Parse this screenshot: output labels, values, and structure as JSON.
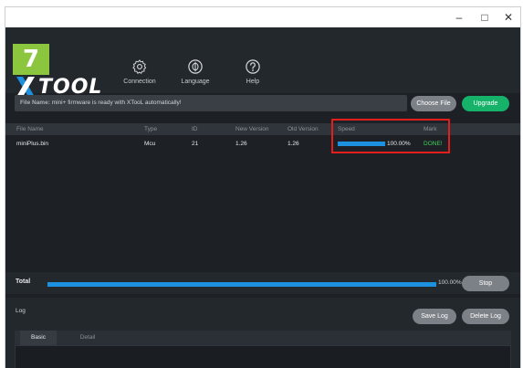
{
  "step_badge": "7",
  "brand": {
    "name": "TOOL"
  },
  "window_controls": {
    "minimize": "–",
    "maximize": "□",
    "close": "✕"
  },
  "nav": [
    {
      "label": "Connection",
      "icon": "gear-icon"
    },
    {
      "label": "Language",
      "icon": "globe-icon"
    },
    {
      "label": "Help",
      "icon": "help-icon"
    }
  ],
  "file_bar": {
    "prefix": "File Name:",
    "text": "mini+ firmware is ready with XTooL automatically!"
  },
  "buttons": {
    "choose_file": "Choose File",
    "upgrade": "Upgrade",
    "stop": "Stop",
    "save_log": "Save Log",
    "delete_log": "Delete Log"
  },
  "table": {
    "headers": [
      "File Name",
      "Type",
      "ID",
      "New Version",
      "Old Version",
      "Speed",
      "Mark"
    ],
    "rows": [
      {
        "file_name": "miniPlus.bin",
        "type": "Mcu",
        "id": "21",
        "new_version": "1.26",
        "old_version": "1.26",
        "speed": "100.00%",
        "speed_fraction": 1.0,
        "mark": "DONE!"
      }
    ]
  },
  "total": {
    "label": "Total",
    "percent": "100.00%",
    "fraction": 1.0
  },
  "log": {
    "label": "Log",
    "tabs": [
      "Basic",
      "Detail"
    ]
  },
  "colors": {
    "accent_green": "#17b26a",
    "progress_blue": "#1e90e0",
    "highlight_red": "#e41d1d",
    "badge_green": "#8cc63f"
  }
}
